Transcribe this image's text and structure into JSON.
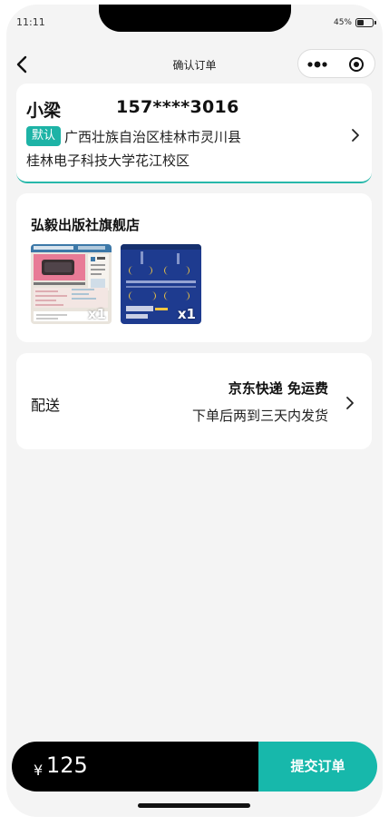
{
  "status_bar": {
    "time": "11:11",
    "battery": "45%",
    "battery_level": 0.45
  },
  "nav": {
    "title": "确认订单",
    "back_icon": "chevron-left-icon",
    "more_icon": "more-dots-icon",
    "close_icon": "target-icon"
  },
  "address": {
    "name": "小梁",
    "phone": "157****3016",
    "tag": "默认",
    "line1": "广西壮族自治区桂林市灵川县",
    "line2": "桂林电子科技大学花江校区"
  },
  "shop": {
    "name": "弘毅出版社旗舰店",
    "products": [
      {
        "qty": "x1"
      },
      {
        "qty": "x1"
      }
    ]
  },
  "shipping": {
    "label": "配送",
    "method": "京东快递 免运费",
    "time": "下单后两到三天内发货"
  },
  "footer": {
    "currency": "¥",
    "price": "125",
    "submit_label": "提交订单"
  },
  "colors": {
    "accent": "#17b8ab",
    "price_bar": "#000000",
    "background": "#f4f4f4"
  }
}
